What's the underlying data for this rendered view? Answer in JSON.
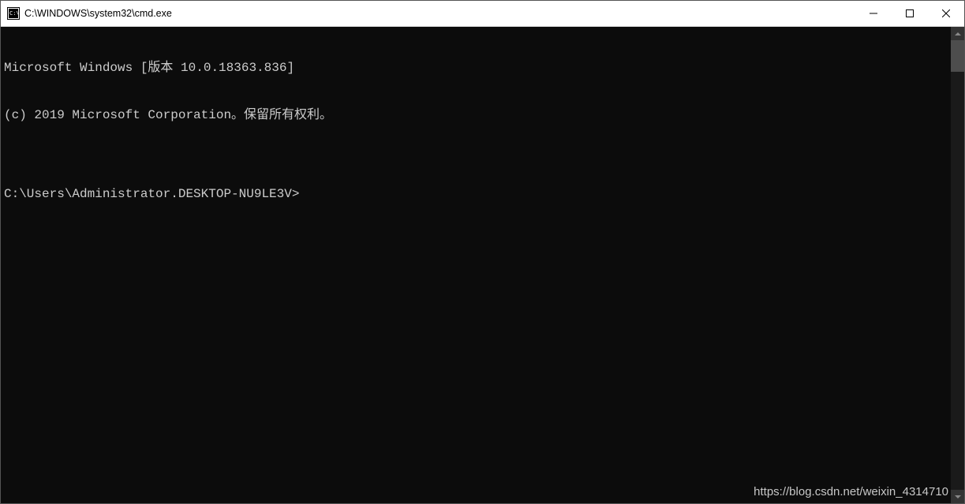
{
  "titlebar": {
    "title": "C:\\WINDOWS\\system32\\cmd.exe"
  },
  "console": {
    "line1": "Microsoft Windows [版本 10.0.18363.836]",
    "line2": "(c) 2019 Microsoft Corporation。保留所有权利。",
    "blank": "",
    "prompt": "C:\\Users\\Administrator.DESKTOP-NU9LE3V>"
  },
  "watermark": "https://blog.csdn.net/weixin_4314710"
}
